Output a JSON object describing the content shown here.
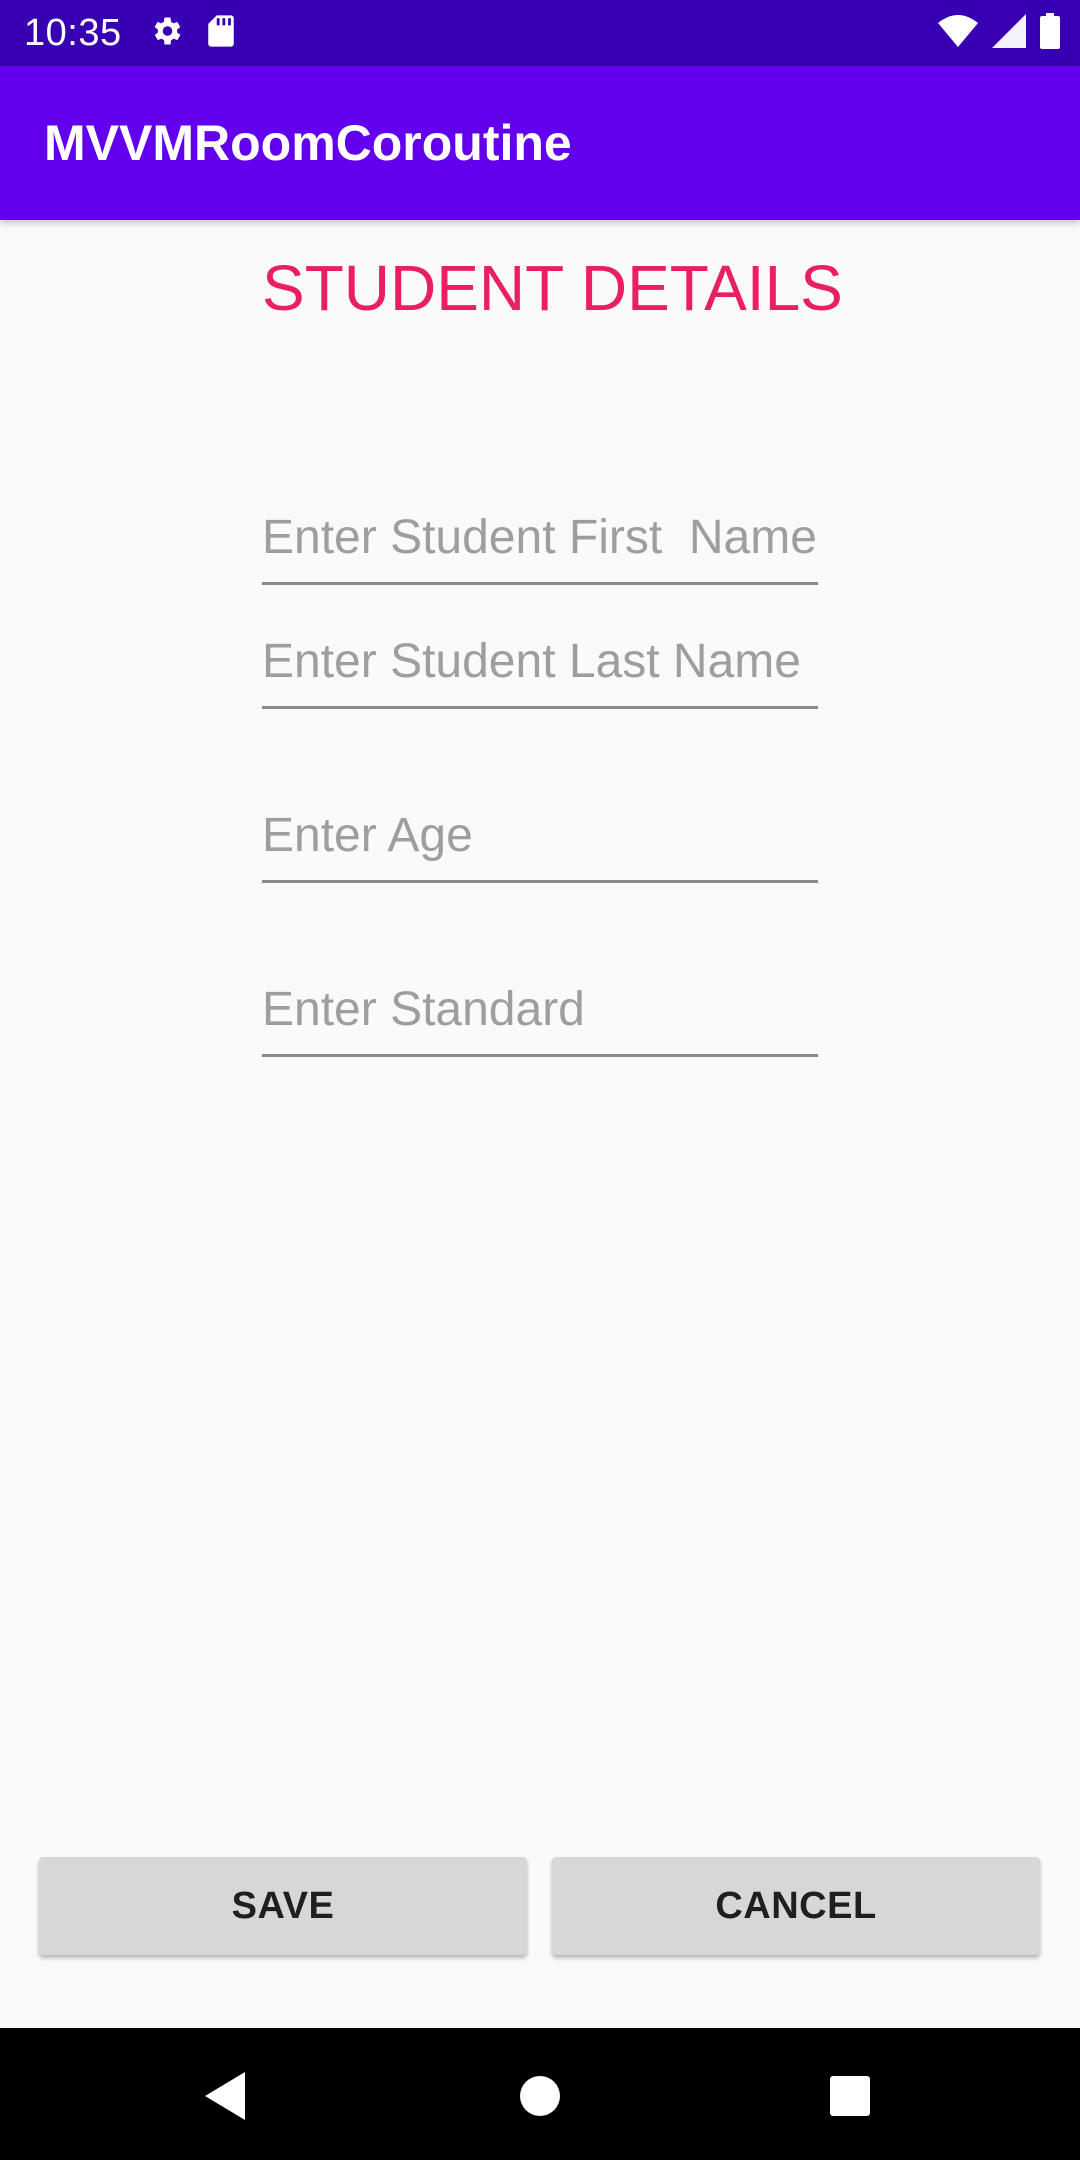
{
  "status_bar": {
    "time": "10:35",
    "icons": [
      "gear-icon",
      "sd-card-icon",
      "wifi-icon",
      "signal-icon",
      "battery-icon"
    ]
  },
  "app_bar": {
    "title": "MVVMRoomCoroutine"
  },
  "form": {
    "title": "STUDENT DETAILS",
    "first_name": {
      "placeholder": "Enter Student First  Name",
      "value": ""
    },
    "last_name": {
      "placeholder": "Enter Student Last Name",
      "value": ""
    },
    "age": {
      "placeholder": "Enter Age",
      "value": ""
    },
    "standard": {
      "placeholder": "Enter Standard",
      "value": ""
    }
  },
  "actions": {
    "save_label": "SAVE",
    "cancel_label": "CANCEL"
  },
  "nav_bar": {
    "icons": [
      "back-icon",
      "home-icon",
      "recents-icon"
    ]
  },
  "colors": {
    "status_bar": "#3700b3",
    "app_bar": "#6200ee",
    "title_accent": "#e91e63",
    "button_bg": "#d6d7d7",
    "background": "#fafafa"
  }
}
